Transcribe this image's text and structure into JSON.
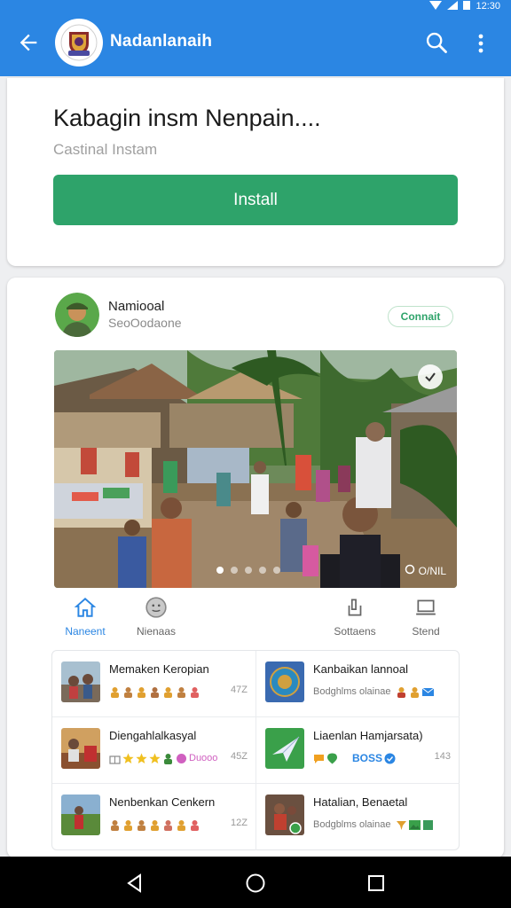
{
  "status_bar": {
    "time": "12:30"
  },
  "app_bar": {
    "title": "Nadanlanaih"
  },
  "install_card": {
    "headline": "Kabagin insm Nenpain....",
    "subtitle": "Castinal Instam",
    "install_label": "Install"
  },
  "post": {
    "author_name": "Namiooal",
    "author_handle": "SeoOodaone",
    "connect_label": "Connait",
    "photo_credit": "O/NIL",
    "carousel_pages": 5,
    "carousel_active": 1
  },
  "nav": {
    "items": [
      {
        "label": "Naneent",
        "icon": "home-icon"
      },
      {
        "label": "Nienaas",
        "icon": "face-icon"
      },
      {
        "label": "Sottaens",
        "icon": "share-icon"
      },
      {
        "label": "Stend",
        "icon": "laptop-icon"
      }
    ],
    "active_color": "#2b86e3"
  },
  "list": {
    "items": [
      {
        "title": "Memaken Keropian",
        "meta": "",
        "num": "47Z"
      },
      {
        "title": "Kanbaikan lannoal",
        "meta": "Bodghlms olainae",
        "num": ""
      },
      {
        "title": "Diengahlalkasyal",
        "meta": "Duooo",
        "num": "45Z"
      },
      {
        "title": "Liaenlan Hamjarsata)",
        "meta": "BOSS",
        "num": "143"
      },
      {
        "title": "Nenbenkan Cenkern",
        "meta": "",
        "num": "12Z"
      },
      {
        "title": "Hatalian, Benaetal",
        "meta": "Bodgblms olainae",
        "num": ""
      }
    ]
  },
  "colors": {
    "primary": "#2b86e3",
    "install_green": "#2ea36a"
  }
}
